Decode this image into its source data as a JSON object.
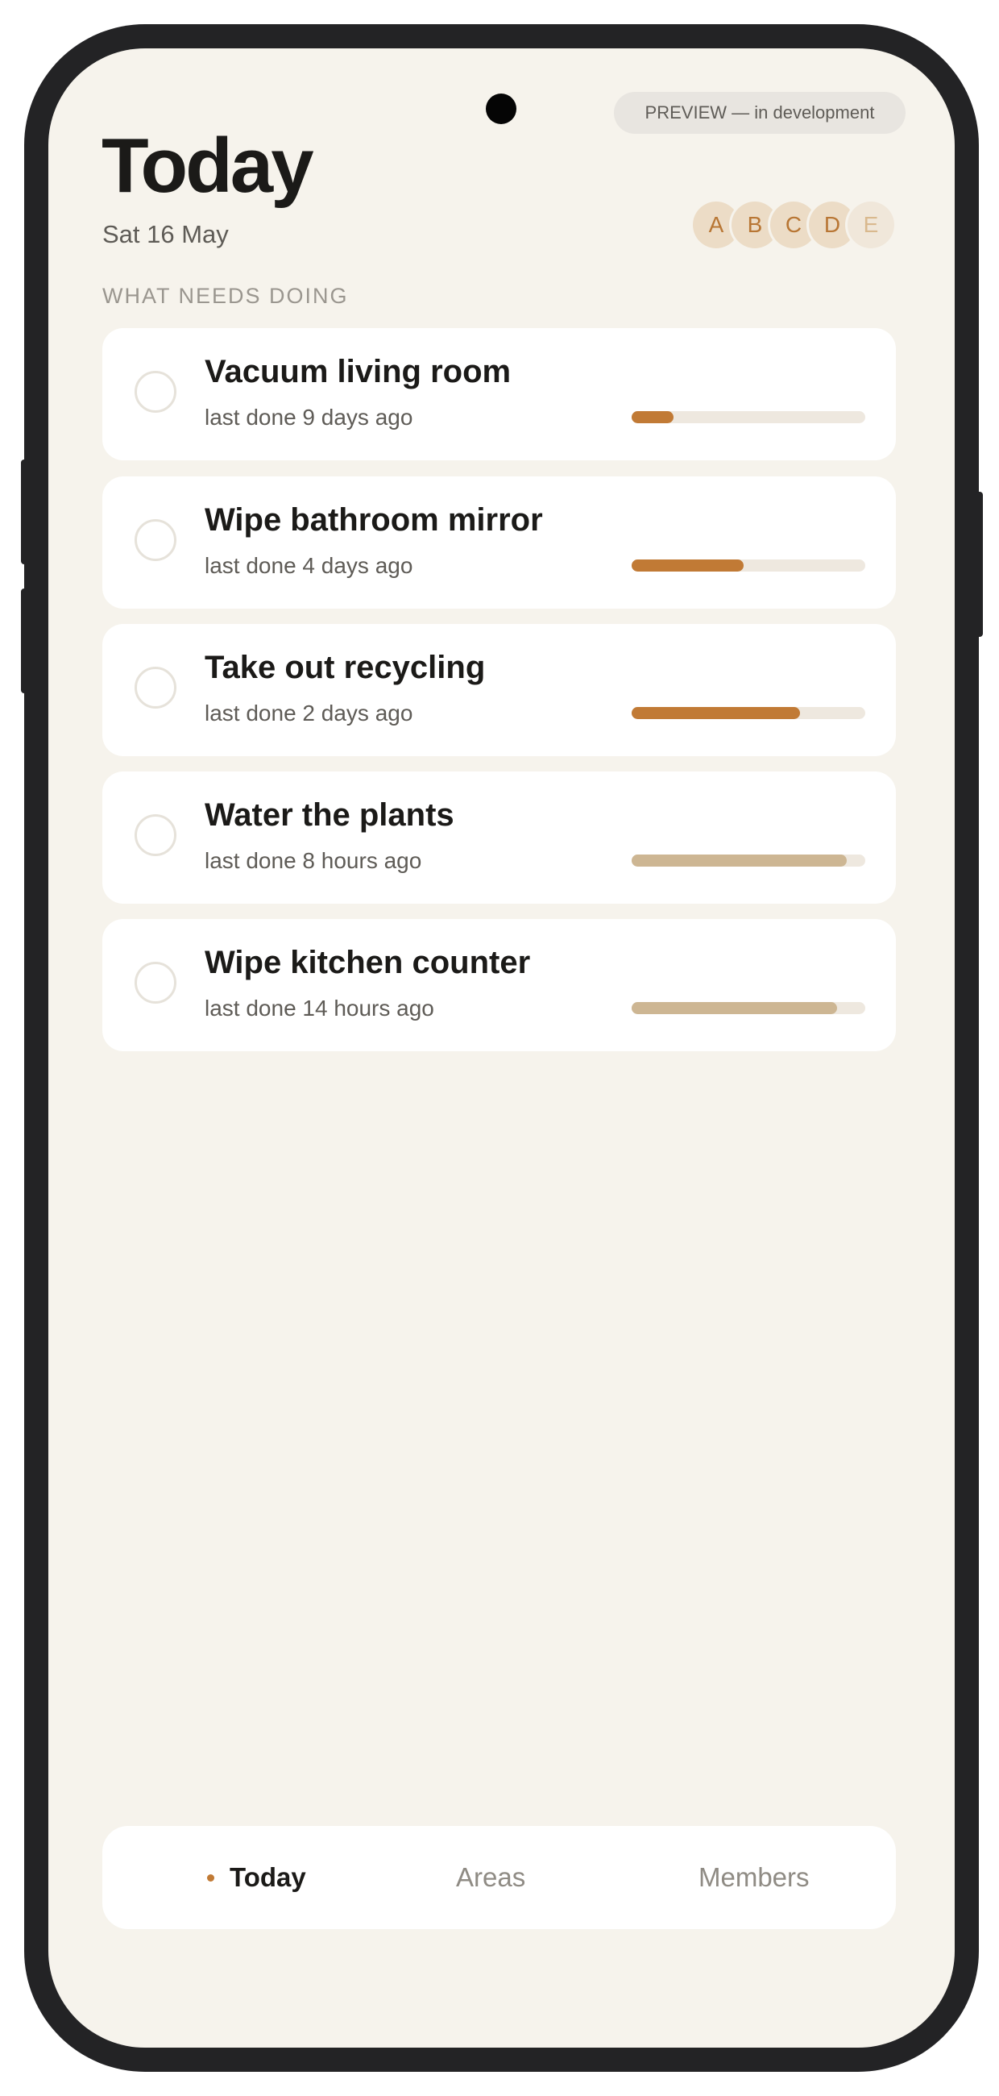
{
  "device": {
    "camera_icon": "camera-dot-icon"
  },
  "header": {
    "preview_badge": "PREVIEW — in development",
    "title": "Today",
    "date": "Sat 16 May"
  },
  "members": [
    {
      "initial": "A",
      "dim": false
    },
    {
      "initial": "B",
      "dim": false
    },
    {
      "initial": "C",
      "dim": false
    },
    {
      "initial": "D",
      "dim": false
    },
    {
      "initial": "E",
      "dim": true
    }
  ],
  "section_label": "WHAT NEEDS DOING",
  "tasks": [
    {
      "title": "Vacuum living room",
      "subtitle": "last done 9 days ago",
      "progress": 0.18,
      "status": "due"
    },
    {
      "title": "Wipe bathroom mirror",
      "subtitle": "last done 4 days ago",
      "progress": 0.48,
      "status": "due"
    },
    {
      "title": "Take out recycling",
      "subtitle": "last done 2 days ago",
      "progress": 0.72,
      "status": "due"
    },
    {
      "title": "Water the plants",
      "subtitle": "last done 8 hours ago",
      "progress": 0.92,
      "status": "fresh"
    },
    {
      "title": "Wipe kitchen counter",
      "subtitle": "last done 14 hours ago",
      "progress": 0.88,
      "status": "fresh"
    }
  ],
  "nav": {
    "today": "Today",
    "areas": "Areas",
    "members": "Members",
    "active": "today"
  },
  "colors": {
    "accent": "#c17a35",
    "fresh": "#cdb693",
    "background": "#f6f3ec",
    "card": "#ffffff"
  }
}
